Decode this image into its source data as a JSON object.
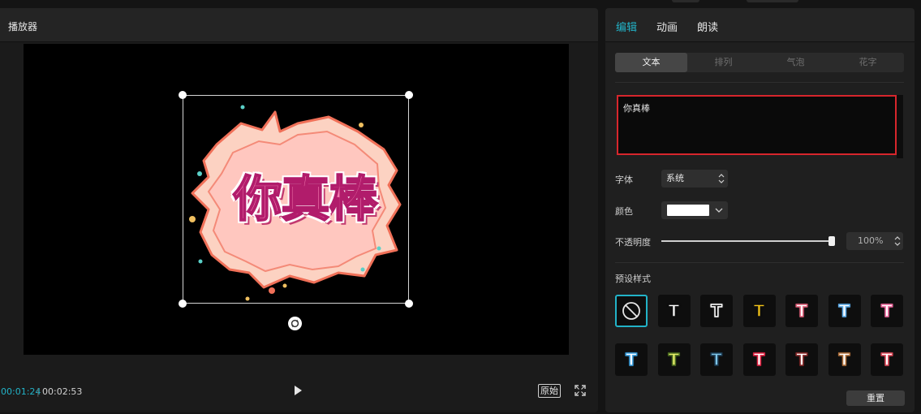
{
  "player": {
    "title": "播放器",
    "sticker_text": "你真棒",
    "timecode_current": "00:01:24",
    "timecode_separator": "|",
    "timecode_total": "00:02:53",
    "original_label": "原始"
  },
  "inspector": {
    "tabs": [
      {
        "label": "编辑",
        "active": true
      },
      {
        "label": "动画",
        "active": false
      },
      {
        "label": "朗读",
        "active": false
      }
    ],
    "subtabs": [
      {
        "label": "文本",
        "active": true
      },
      {
        "label": "排列",
        "active": false
      },
      {
        "label": "气泡",
        "active": false
      },
      {
        "label": "花字",
        "active": false
      }
    ],
    "text_value": "你真棒",
    "font": {
      "label": "字体",
      "value": "系统"
    },
    "color": {
      "label": "颜色",
      "value": "#ffffff"
    },
    "opacity": {
      "label": "不透明度",
      "value": "100%",
      "fraction": 1.0
    },
    "presets_title": "预设样式",
    "presets": [
      {
        "glyph": "",
        "icon": "none-icon",
        "fill": "",
        "stroke": "",
        "selected": true
      },
      {
        "glyph": "T",
        "fill": "#ffffff",
        "stroke": "#0e0e0e"
      },
      {
        "glyph": "T",
        "fill": "#0e0e0e",
        "stroke": "#ffffff"
      },
      {
        "glyph": "T",
        "fill": "#f5c518",
        "stroke": "#0e0e0e"
      },
      {
        "glyph": "T",
        "fill": "#ffffff",
        "stroke": "#e0607a"
      },
      {
        "glyph": "T",
        "fill": "#ffffff",
        "stroke": "#5aa9e6"
      },
      {
        "glyph": "T",
        "fill": "#ffffff",
        "stroke": "#f06aa0"
      },
      {
        "glyph": "T",
        "fill": "#ffffff",
        "stroke": "#3aa0e0"
      },
      {
        "glyph": "T",
        "fill": "#e9f06a",
        "stroke": "#4a6a20"
      },
      {
        "glyph": "T",
        "fill": "#7fc6e8",
        "stroke": "#1e3d55"
      },
      {
        "glyph": "T",
        "fill": "#ffffff",
        "stroke": "#e02040"
      },
      {
        "glyph": "T",
        "fill": "#ffffff",
        "stroke": "#8a2a2a"
      },
      {
        "glyph": "T",
        "fill": "#ffffff",
        "stroke": "#b0703a"
      },
      {
        "glyph": "T",
        "fill": "#ffffff",
        "stroke": "#e04a5a"
      }
    ],
    "reset_label": "重置"
  },
  "colors": {
    "accent": "#22b3c8",
    "highlight_border": "#d7262c",
    "panel_bg": "#1f1f1f",
    "stage_bg": "#000000"
  }
}
